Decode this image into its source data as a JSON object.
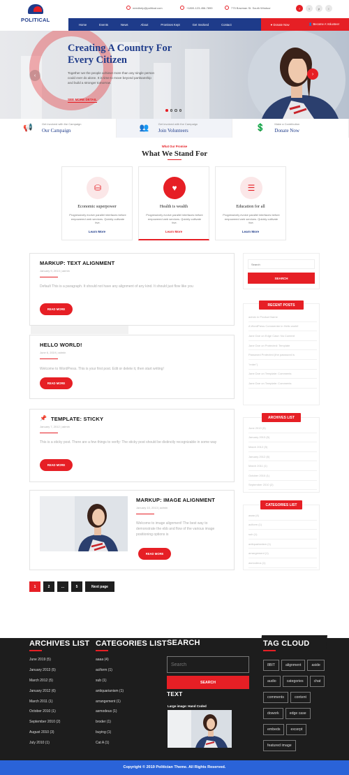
{
  "brand": {
    "logo_text": "POLITICAL"
  },
  "topbar": {
    "email": "needhelp@political.com",
    "phone": "+1800-123-456-7899",
    "address": "775 Bowman St. South Windsor",
    "social": [
      "f",
      "t",
      "p",
      "i"
    ]
  },
  "nav": {
    "items": [
      "Home",
      "Events",
      "News",
      "About",
      "Promises Kept",
      "Get Involved",
      "Contact"
    ],
    "donate_label": "Donate Now",
    "volunteer_label": "Become A Volunteer"
  },
  "hero": {
    "title": "Creating A Country For Every Citizen",
    "text": "Together we the people achieve more than any single person could ever do alone. It is time to move beyond partisanship and build a stronger tomorrow.",
    "cta": "SEE MORE DETAIL",
    "slide_count": 4,
    "active_slide": 1
  },
  "strip": [
    {
      "sub": "Get involved with the Campaign",
      "title": "Our Campaign",
      "icon": "megaphone-icon"
    },
    {
      "sub": "Get involved with the Campaign",
      "title": "Join Volunteers",
      "icon": "volunteers-icon"
    },
    {
      "sub": "Make a Contribution",
      "title": "Donate Now",
      "icon": "donate-icon"
    }
  ],
  "promise": {
    "sub": "What Our Promise",
    "title": "What We Stand For"
  },
  "stands": [
    {
      "title": "Economic superpower",
      "desc": "Progressively evolve parallel interfaces before empowered web services. Quickly cultivate tive.",
      "link": "Learn More",
      "icon": "coins-icon"
    },
    {
      "title": "Health is wealth",
      "desc": "Progressively evolve parallel interfaces before empowered web services. Quickly cultivate tive.",
      "link": "Learn More",
      "icon": "heart-pulse-icon"
    },
    {
      "title": "Education for all",
      "desc": "Progressively evolve parallel interfaces before empowered web services. Quickly cultivate tive.",
      "link": "Learn More",
      "icon": "books-icon"
    }
  ],
  "posts": [
    {
      "title": "MARKUP: TEXT ALIGNMENT",
      "meta": "January 9, 2013  |  admin",
      "excerpt": "Default This is a paragraph. It should not have any alignment of any kind. It should just flow like you",
      "button": "READ MORE"
    },
    {
      "title": "HELLO WORLD!",
      "meta": "June 6, 2019  |  admin",
      "excerpt": "Welcome to WordPress. This is your first post. Edit or delete it, then start writing!",
      "button": "READ MORE"
    },
    {
      "title": "TEMPLATE: STICKY",
      "meta": "January 7, 2012  |  admin",
      "excerpt": "This is a sticky post. There are a few things to verify: The sticky post should be distinctly recognizable in some way",
      "button": "READ MORE"
    },
    {
      "title": "MARKUP: IMAGE ALIGNMENT",
      "meta": "January 10, 2013  |  admin",
      "excerpt": "Welcome to image alignment! The best way to demonstrate the ebb and flow of the various image positioning options is",
      "button": "READ MORE"
    }
  ],
  "sidebar": {
    "search_placeholder": "Search",
    "search_button": "SEARCH",
    "recent_title": "RECENT POSTS",
    "recent": [
      "admin in Product Name",
      "A WordPress Commenter in Hello world!",
      "Jane Doe on Edge Case: No Content",
      "Jane Doe on Protected: Template",
      "Password Protected (the password is",
      "\"enter\")",
      "Jane Doe on Template: Comments",
      "Jane Doe on Template: Comments"
    ],
    "archives_title": "ARCHIVES LIST",
    "archives": [
      "June 2019 (5)",
      "January 2013 (5)",
      "March 2012 (5)",
      "January 2012 (6)",
      "March 2011 (1)",
      "October 2010 (1)",
      "September 2010 (2)"
    ],
    "categories_title": "CATEGORIES LIST",
    "categories": [
      "aaaa (4)",
      "aciform (1)",
      "sub (1)",
      "antiquarianism (1)",
      "arrangement (1)",
      "asmodeus (1)"
    ]
  },
  "pagination": [
    "1",
    "2",
    "...",
    "5",
    "Next page"
  ],
  "footer": {
    "archives_title": "ARCHIVES LIST",
    "archives": [
      "June 2019 (5)",
      "January 2013 (5)",
      "March 2012 (5)",
      "January 2012 (6)",
      "March 2011 (1)",
      "October 2010 (1)",
      "September 2010 (2)",
      "August 2010 (3)",
      "July 2010 (1)"
    ],
    "categories_title": "CATEGORIES LIST",
    "categories": [
      "aaaa (4)",
      "aciform (1)",
      "sub (1)",
      "antiquarianism (1)",
      "arrangement (1)",
      "asmodeus (1)",
      "broder (1)",
      "buying (1)",
      "Cat A (1)"
    ],
    "search_title": "SEARCH",
    "search_placeholder": "Search",
    "search_button": "SEARCH",
    "text_title": "TEXT",
    "image_caption": "Large image: Hand Coded",
    "tags_title": "TAG CLOUD",
    "tags": [
      "8BIT",
      "alignment",
      "aside",
      "audio",
      "categories",
      "chat",
      "comments",
      "content",
      "dowork",
      "edge case",
      "embeds",
      "excerpt",
      "featured image"
    ]
  },
  "copyright": "Copyright © 2019 Politician Theme. All Rights Reserved.",
  "colors": {
    "primary": "#1e3b8a",
    "accent": "#e61f25",
    "footer": "#1d1d1d",
    "copyright": "#2a63d8"
  }
}
